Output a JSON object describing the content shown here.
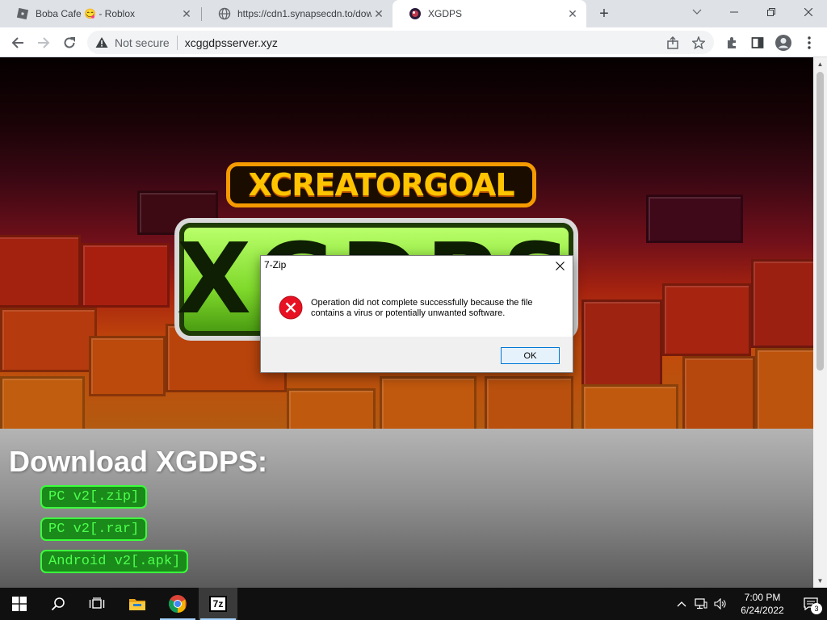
{
  "browser": {
    "tabs": [
      {
        "title": "Boba Cafe 😋 - Roblox",
        "favicon": "roblox-icon",
        "active": false
      },
      {
        "title": "https://cdn1.synapsecdn.to/dow",
        "favicon": "globe-icon",
        "active": false
      },
      {
        "title": "XGDPS",
        "favicon": "xgdps-icon",
        "active": true
      }
    ],
    "new_tab_label": "+",
    "security_label": "Not secure",
    "url": "xcggdpsserver.xyz"
  },
  "page": {
    "logo_top": "XCREATORGOAL",
    "logo_main": "XGDPS",
    "download_title": "Download XGDPS:",
    "downloads": [
      "PC v2[.zip]",
      "PC v2[.rar]",
      "Android v2[.apk]"
    ]
  },
  "dialog": {
    "title": "7-Zip",
    "message": "Operation did not complete successfully because the file contains a virus or potentially unwanted software.",
    "ok_label": "OK"
  },
  "taskbar": {
    "apps": [
      "start-icon",
      "search-icon",
      "task-view-icon",
      "file-explorer-icon",
      "chrome-icon",
      "7zip-icon"
    ],
    "time": "7:00 PM",
    "date": "6/24/2022",
    "notification_count": "3",
    "sevenzip_label": "7z"
  },
  "colors": {
    "accent": "#0078d7",
    "error": "#e81123",
    "download_text": "#4dff4d",
    "download_bg": "#1a8a1a"
  }
}
